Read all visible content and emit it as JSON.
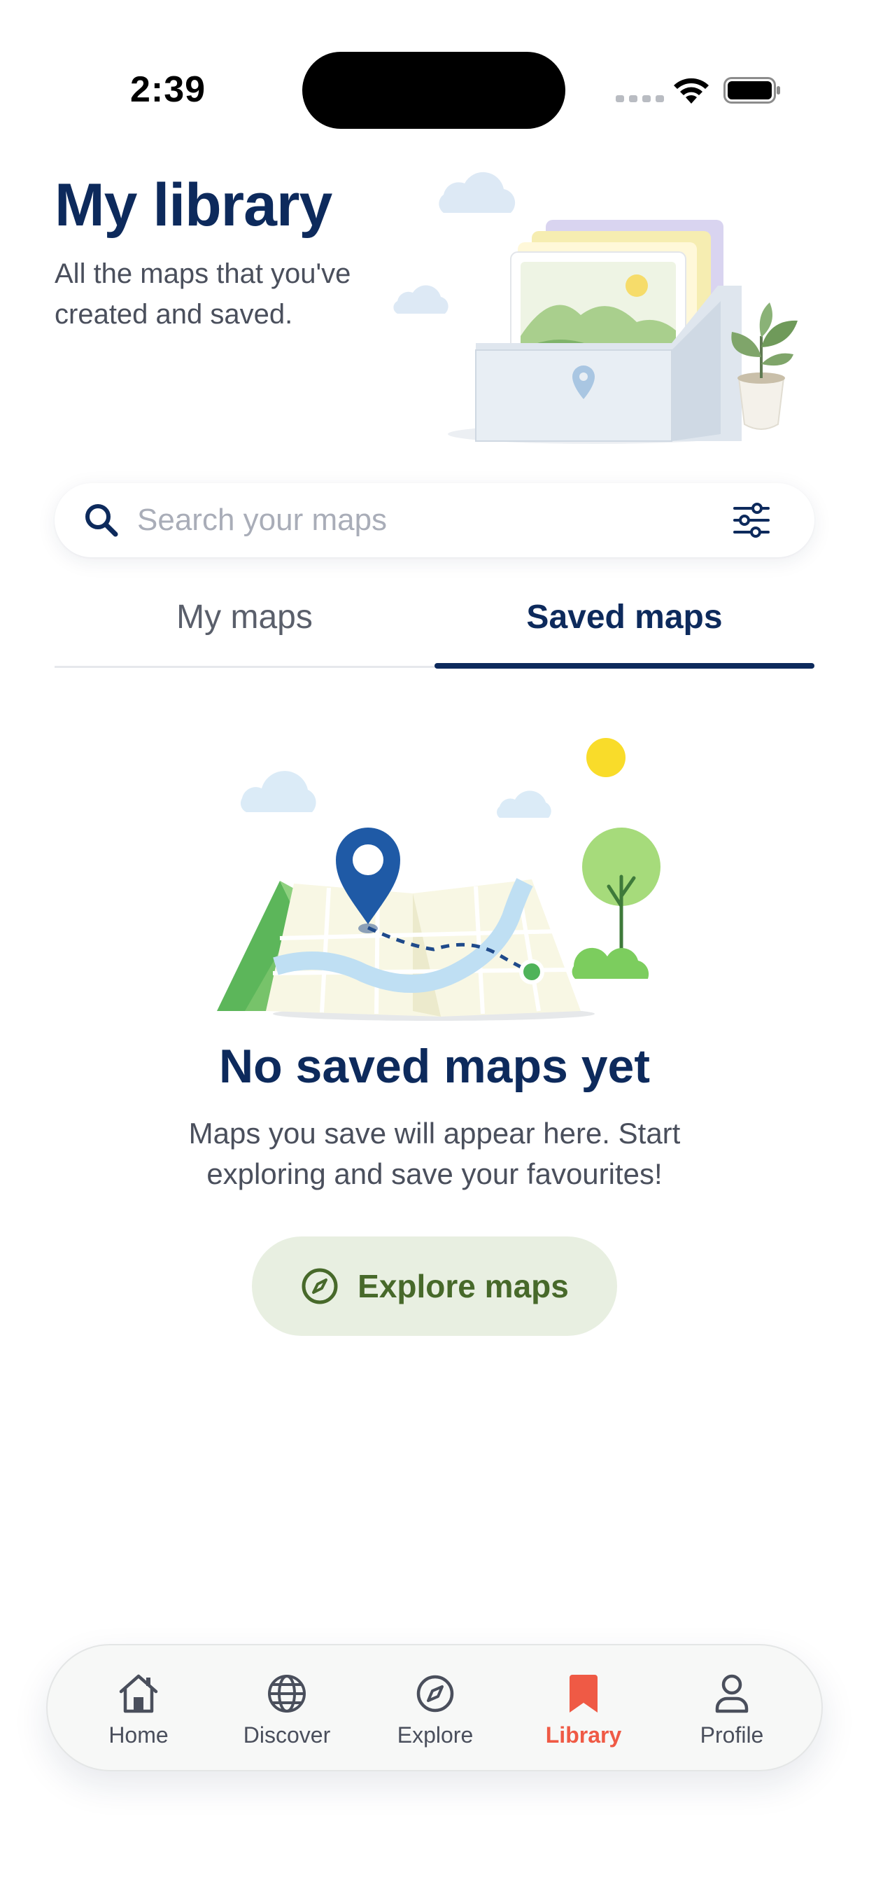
{
  "status_bar": {
    "time": "2:39"
  },
  "header": {
    "title": "My library",
    "subtitle": "All the maps that you've created and saved."
  },
  "search": {
    "placeholder": "Search your maps",
    "value": ""
  },
  "tabs": [
    {
      "label": "My maps",
      "active": false
    },
    {
      "label": "Saved maps",
      "active": true
    }
  ],
  "empty_state": {
    "title": "No saved maps yet",
    "message": "Maps you save will appear here. Start exploring and save your favourites!",
    "button_label": "Explore maps",
    "button_icon": "compass-icon"
  },
  "bottom_nav": {
    "items": [
      {
        "label": "Home",
        "icon": "home-icon",
        "active": false
      },
      {
        "label": "Discover",
        "icon": "globe-icon",
        "active": false
      },
      {
        "label": "Explore",
        "icon": "compass-icon",
        "active": false
      },
      {
        "label": "Library",
        "icon": "bookmark-icon",
        "active": true
      },
      {
        "label": "Profile",
        "icon": "person-icon",
        "active": false
      }
    ]
  },
  "colors": {
    "primary": "#0d2a5c",
    "accent_active": "#ef5a45",
    "button_bg": "#e8efe1",
    "button_text": "#47692a"
  }
}
